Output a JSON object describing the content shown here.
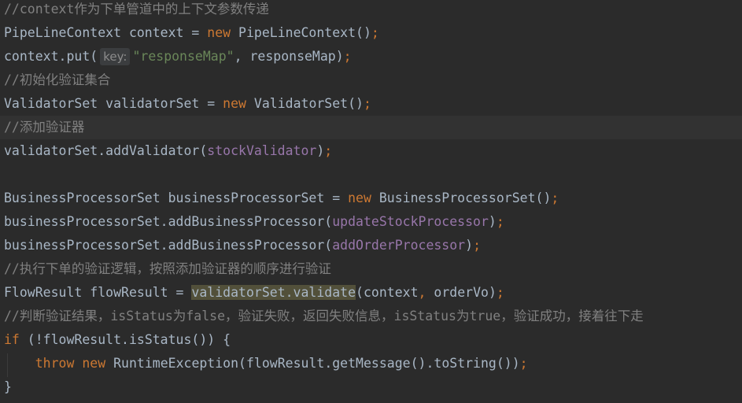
{
  "code": {
    "l1": {
      "comment": "//context作为下单管道中的上下文参数传递"
    },
    "l2": {
      "a": "PipeLineContext context = ",
      "kw": "new",
      "b": " PipeLineContext()",
      "semi": ";"
    },
    "l3": {
      "a": "context.put(",
      "hint": "key:",
      "str": "\"responseMap\"",
      "b": ", responseMap)",
      "semi": ";"
    },
    "l4": {
      "comment": "//初始化验证集合"
    },
    "l5": {
      "a": "ValidatorSet validatorSet = ",
      "kw": "new",
      "b": " ValidatorSet()",
      "semi": ";"
    },
    "l6": {
      "comment": "//添加验证器"
    },
    "l7": {
      "a": "validatorSet.addValidator(",
      "field": "stockValidator",
      "b": ")",
      "semi": ";"
    },
    "l9": {
      "a": "BusinessProcessorSet businessProcessorSet = ",
      "kw": "new",
      "b": " BusinessProcessorSet()",
      "semi": ";"
    },
    "l10": {
      "a": "businessProcessorSet.addBusinessProcessor(",
      "field": "updateStockProcessor",
      "b": ")",
      "semi": ";"
    },
    "l11": {
      "a": "businessProcessorSet.addBusinessProcessor(",
      "field": "addOrderProcessor",
      "b": ")",
      "semi": ";"
    },
    "l12": {
      "comment": "//执行下单的验证逻辑，按照添加验证器的顺序进行验证"
    },
    "l13": {
      "a": "FlowResult flowResult = ",
      "hl": "validatorSet.validate",
      "b": "(context",
      "comma": ",",
      "c": " orderVo)",
      "semi": ";"
    },
    "l14": {
      "comment": "//判断验证结果，isStatus为false，验证失败，返回失败信息，isStatus为true，验证成功，接着往下走"
    },
    "l15": {
      "kw": "if",
      "a": " (!flowResult.isStatus()) {"
    },
    "l16": {
      "indent": "    ",
      "kw1": "throw",
      "sp": " ",
      "kw2": "new",
      "a": " RuntimeException(flowResult.getMessage().toString())",
      "semi": ";"
    },
    "l17": {
      "a": "}"
    }
  },
  "colors": {
    "background": "#2b2b2b",
    "current_line": "#323232",
    "text": "#a9b7c6",
    "comment": "#808080",
    "keyword": "#cc7832",
    "string": "#6a8759",
    "field": "#9876aa",
    "highlight": "#52503a"
  }
}
